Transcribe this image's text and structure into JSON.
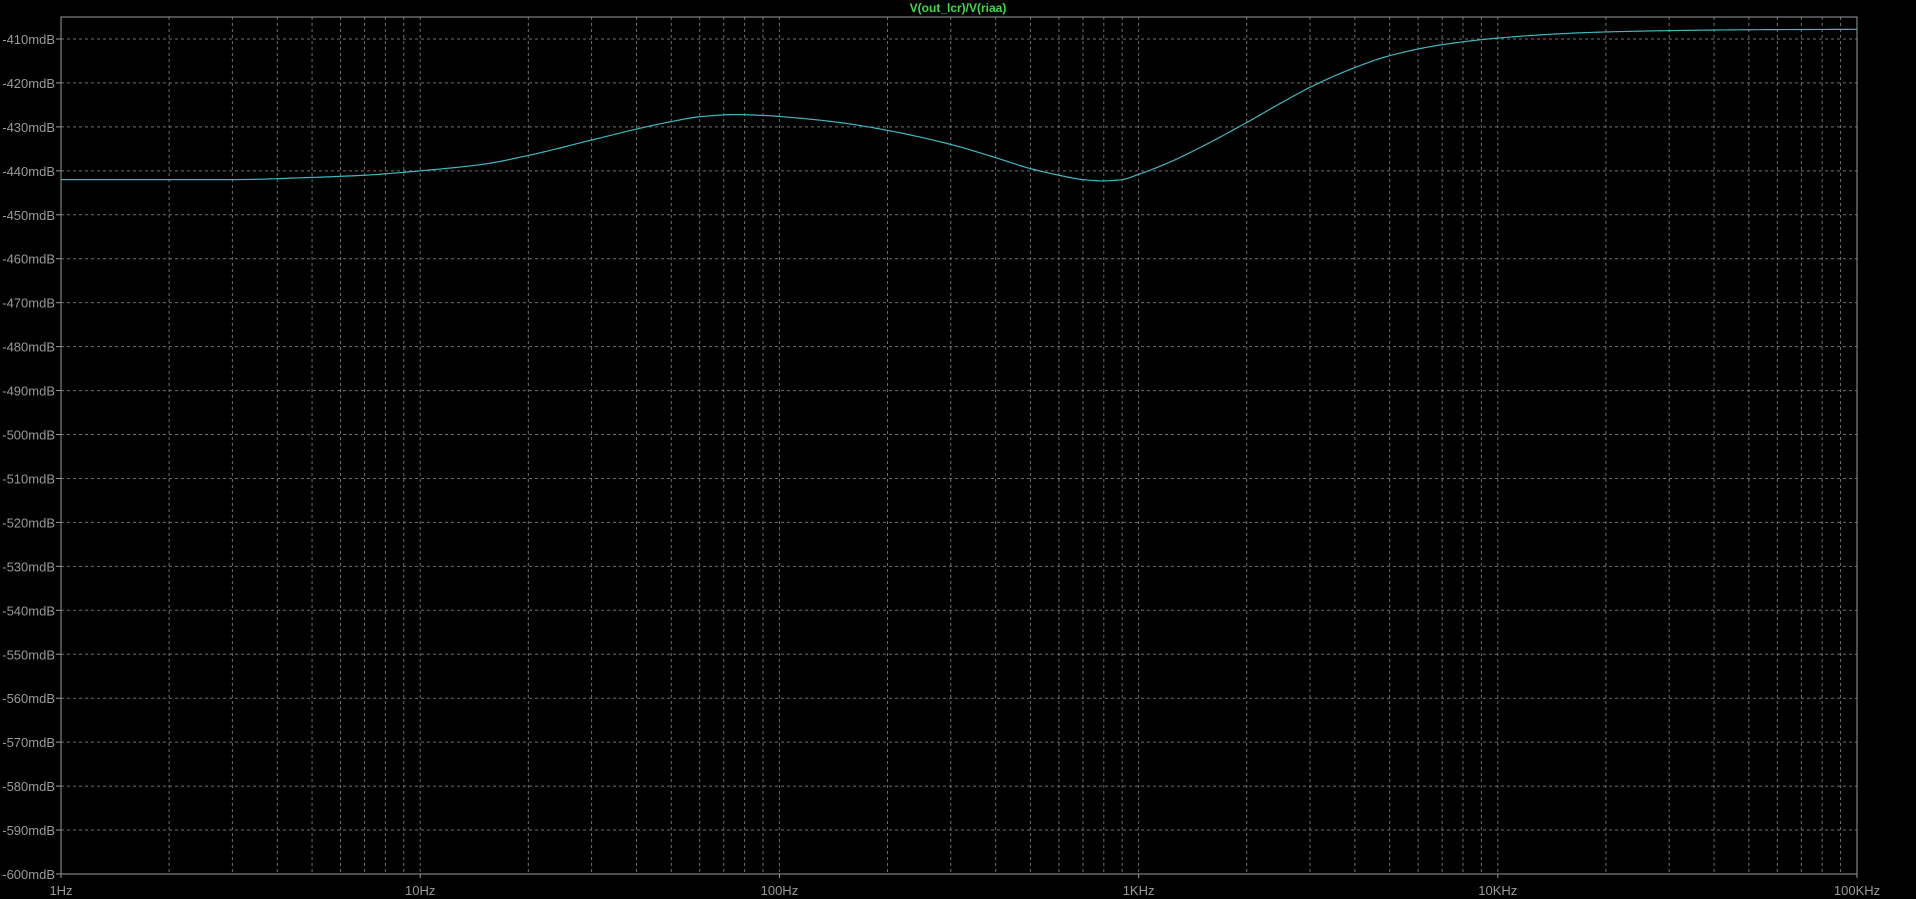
{
  "colors": {
    "background": "#000000",
    "grid": "#6f6f6f",
    "frame": "#9a9a9a",
    "trace": "#3fb6c2",
    "trace_title": "#3ddc4a",
    "tick_text": "#9a9a9a"
  },
  "chart_data": {
    "type": "line",
    "title": "V(out_lcr)/V(riaa)",
    "xlabel": "",
    "ylabel": "",
    "x_scale": "log",
    "xlim": [
      1,
      100000
    ],
    "ylim": [
      -600,
      -405
    ],
    "grid": true,
    "x_ticks": [
      {
        "value": 1,
        "label": "1Hz"
      },
      {
        "value": 10,
        "label": "10Hz"
      },
      {
        "value": 100,
        "label": "100Hz"
      },
      {
        "value": 1000,
        "label": "1KHz"
      },
      {
        "value": 10000,
        "label": "10KHz"
      },
      {
        "value": 100000,
        "label": "100KHz"
      }
    ],
    "y_ticks": [
      {
        "value": -410,
        "label": "-410mdB"
      },
      {
        "value": -420,
        "label": "-420mdB"
      },
      {
        "value": -430,
        "label": "-430mdB"
      },
      {
        "value": -440,
        "label": "-440mdB"
      },
      {
        "value": -450,
        "label": "-450mdB"
      },
      {
        "value": -460,
        "label": "-460mdB"
      },
      {
        "value": -470,
        "label": "-470mdB"
      },
      {
        "value": -480,
        "label": "-480mdB"
      },
      {
        "value": -490,
        "label": "-490mdB"
      },
      {
        "value": -500,
        "label": "-500mdB"
      },
      {
        "value": -510,
        "label": "-510mdB"
      },
      {
        "value": -520,
        "label": "-520mdB"
      },
      {
        "value": -530,
        "label": "-530mdB"
      },
      {
        "value": -540,
        "label": "-540mdB"
      },
      {
        "value": -550,
        "label": "-550mdB"
      },
      {
        "value": -560,
        "label": "-560mdB"
      },
      {
        "value": -570,
        "label": "-570mdB"
      },
      {
        "value": -580,
        "label": "-580mdB"
      },
      {
        "value": -590,
        "label": "-590mdB"
      },
      {
        "value": -600,
        "label": "-600mdB"
      }
    ],
    "series": [
      {
        "x": [
          1,
          2,
          3,
          5,
          7,
          10,
          15,
          20,
          30,
          40,
          50,
          60,
          75,
          90,
          120,
          150,
          200,
          300,
          400,
          500,
          600,
          700,
          800,
          900,
          1000,
          1200,
          1500,
          2000,
          2500,
          3000,
          4000,
          5000,
          7000,
          10000,
          15000,
          20000,
          30000,
          50000,
          100000
        ],
        "values": [
          -442,
          -442,
          -442,
          -441.5,
          -441,
          -440,
          -438.5,
          -436.5,
          -433,
          -430.5,
          -428.8,
          -427.7,
          -427.2,
          -427.4,
          -428.2,
          -429.1,
          -430.8,
          -434,
          -437,
          -439.5,
          -441,
          -442,
          -442.3,
          -442,
          -440.8,
          -438.3,
          -434.5,
          -429,
          -424.5,
          -421,
          -416.5,
          -413.8,
          -411.3,
          -409.8,
          -408.8,
          -408.4,
          -408.1,
          -407.9,
          -407.8
        ]
      }
    ]
  }
}
